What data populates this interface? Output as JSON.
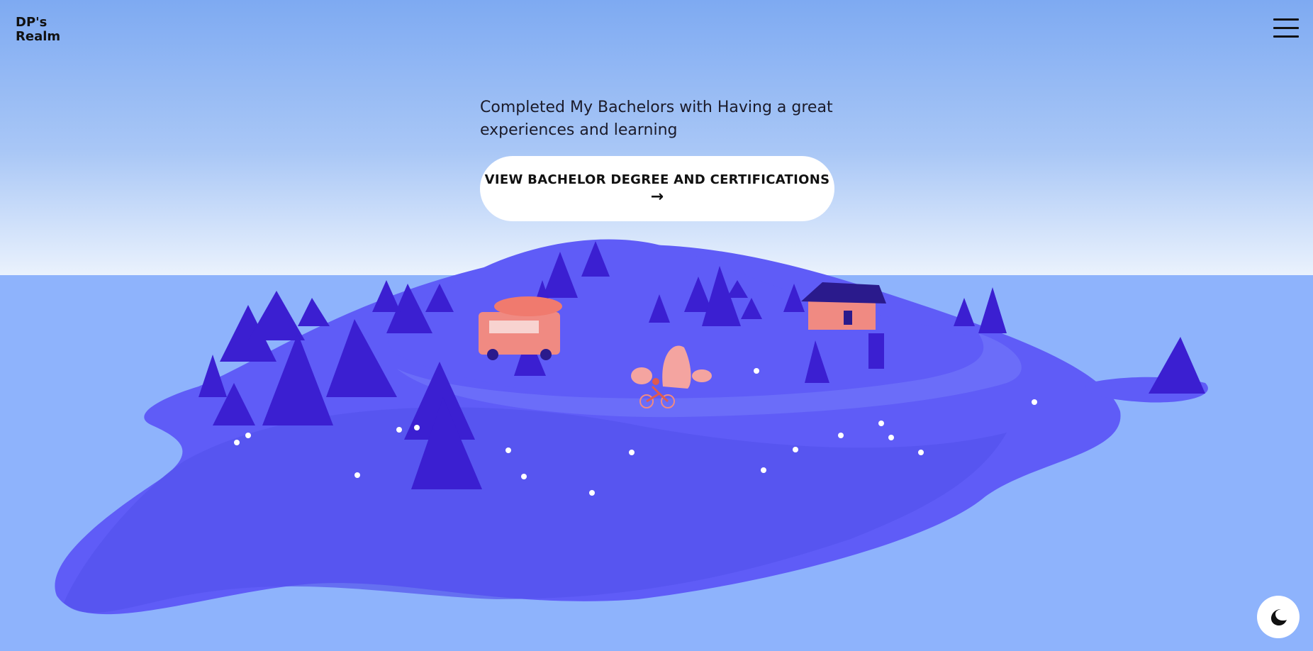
{
  "brand": {
    "logo_text": "DP's\nRealm"
  },
  "hero": {
    "tagline": "Completed My Bachelors with Having a great experiences and learning",
    "cta_label": "VIEW BACHELOR DEGREE AND CERTIFICATIONS",
    "cta_arrow": "→"
  },
  "icons": {
    "menu": "hamburger-menu-icon",
    "theme": "moon-icon",
    "cta_arrow": "arrow-right-icon"
  },
  "colors": {
    "sky_top": "#7eaaf2",
    "sky_horizon": "#eaf2fd",
    "sea": "#8eb3fc",
    "island": "#5f5cf7",
    "trees": "#3b1fd1",
    "accent_coral": "#f08a82",
    "cabin_roof": "#2a1a8c",
    "button_bg": "#ffffff",
    "text": "#111111"
  }
}
